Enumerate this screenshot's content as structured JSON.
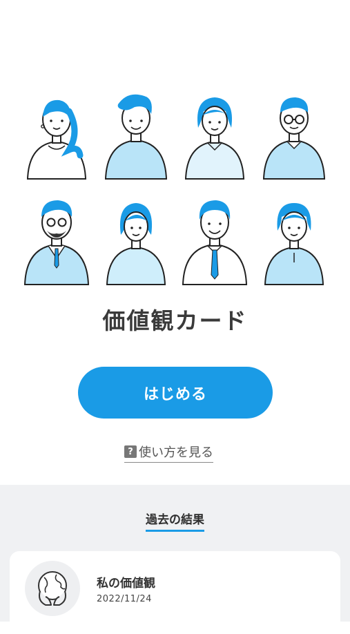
{
  "app": {
    "title": "価値観カード",
    "start_label": "はじめる",
    "howto_label": "使い方を見る",
    "howto_icon": "?"
  },
  "illustration": {
    "icon": "people-illustration",
    "accent_color": "#1a9be6",
    "shirt_color": "#b9e4f8"
  },
  "history": {
    "title": "過去の結果",
    "items": [
      {
        "name": "私の価値観",
        "date": "2022/11/24",
        "icon": "globe-hands-icon"
      }
    ]
  }
}
